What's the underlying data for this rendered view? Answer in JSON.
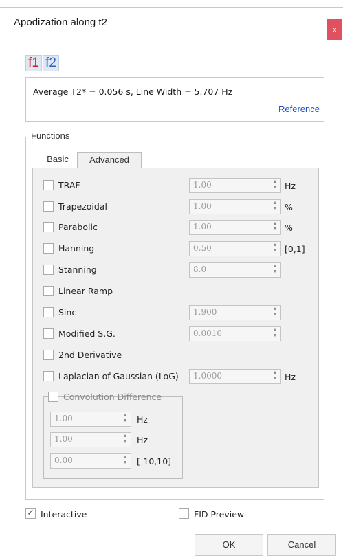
{
  "window": {
    "title": "Apodization along t2",
    "close_label": "x"
  },
  "dimension_buttons": {
    "f1": "f1",
    "f2": "f2"
  },
  "info": {
    "text": "Average T2* = 0.056 s, Line Width = 5.707 Hz",
    "reference_label": "Reference"
  },
  "functions": {
    "legend": "Functions",
    "tabs": {
      "basic": "Basic",
      "advanced": "Advanced"
    },
    "rows": [
      {
        "label": "TRAF",
        "value": "1.00",
        "unit": "Hz"
      },
      {
        "label": "Trapezoidal",
        "value": "1.00",
        "unit": "%"
      },
      {
        "label": "Parabolic",
        "value": "1.00",
        "unit": "%"
      },
      {
        "label": "Hanning",
        "value": "0.50",
        "unit": "[0,1]"
      },
      {
        "label": "Stanning",
        "value": "8.0",
        "unit": ""
      },
      {
        "label": "Linear Ramp",
        "value": "",
        "unit": ""
      },
      {
        "label": "Sinc",
        "value": "1.900",
        "unit": ""
      },
      {
        "label": "Modified S.G.",
        "value": "0.0010",
        "unit": ""
      },
      {
        "label": "2nd Derivative",
        "value": "",
        "unit": ""
      },
      {
        "label": "Laplacian of Gaussian (LoG)",
        "value": "1.0000",
        "unit": "Hz"
      }
    ],
    "convolution": {
      "label": "Convolution Difference",
      "fields": [
        {
          "value": "1.00",
          "unit": "Hz"
        },
        {
          "value": "1.00",
          "unit": "Hz"
        },
        {
          "value": "0.00",
          "unit": "[-10,10]"
        }
      ]
    }
  },
  "options": {
    "interactive_label": "Interactive",
    "interactive_checked": true,
    "fid_preview_label": "FID Preview",
    "fid_preview_checked": false
  },
  "buttons": {
    "ok": "OK",
    "cancel": "Cancel"
  }
}
